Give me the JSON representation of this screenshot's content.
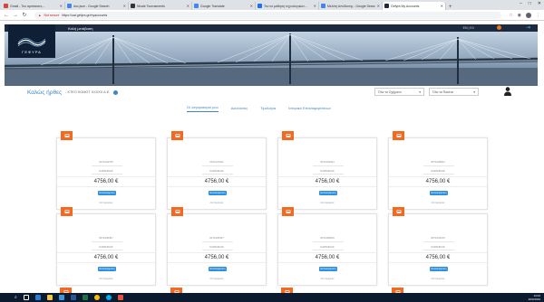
{
  "browser": {
    "tabs": [
      {
        "title": "Gmail - Του αγαπαοτες...",
        "color": "#d44638",
        "active": false
      },
      {
        "title": "doc.json - Google Search",
        "color": "#4285f4",
        "active": false
      },
      {
        "title": "Nivale Tournaments",
        "color": "#333333",
        "active": false
      },
      {
        "title": "Google Translate",
        "color": "#4285f4",
        "active": false
      },
      {
        "title": "Τον σε μάθηση τεχνολογικών...",
        "color": "#1a73e8",
        "active": false
      },
      {
        "title": "Μελέτη Απόδοσης - Google Search",
        "color": "#4285f4",
        "active": false
      },
      {
        "title": "Gefyra My Accounts",
        "color": "#1c2a3f",
        "active": true
      }
    ],
    "new_tab": "+",
    "window_controls": [
      "–",
      "□",
      "✕"
    ],
    "not_secure": "Not secure",
    "url": "https://uat.gefyra.gr/myaccounts"
  },
  "header": {
    "brand": "ΓΕΦΥΡΑ",
    "tagline": "Καλή μετάβαση",
    "lang": "EN | ΕΛ"
  },
  "user": {
    "welcome": "Καλώς ήρθες",
    "company": "- ΚΤΕΟ ΚΟΜΟΤ ΧΧΧΧΧ Α.Ε.",
    "filter1": "Όλα τα Οχήματα",
    "filter2": "Όλα τα Πακέτα",
    "caret": "▾"
  },
  "tabs": [
    {
      "label": "Οι λογαριασμοί μου",
      "active": true
    },
    {
      "label": "Διελεύσεις",
      "active": false
    },
    {
      "label": "Τιμολόγια",
      "active": false
    },
    {
      "label": "Ιστορικό Επαναφορτίσεων",
      "active": false
    }
  ],
  "cards": [
    {
      "line1": "0071234475",
      "line2": "ΚΑΡΑΝΙΚΑΣ",
      "amount": "4756,00 €",
      "button": "Επαναφόρτιση",
      "foot": "Λεπτομέρειες"
    },
    {
      "line1": "0071237011",
      "line2": "ΚΑΡΑΝΙΚΑΣ",
      "amount": "4756,00 €",
      "button": "Επαναφόρτιση",
      "foot": "Λεπτομέρειες"
    },
    {
      "line1": "0071234261",
      "line2": "ΚΑΡΑΝΙΚΑΣ",
      "amount": "4756,00 €",
      "button": "Επαναφόρτιση",
      "foot": "Λεπτομέρειες"
    },
    {
      "line1": "0071235601",
      "line2": "ΚΑΡΑΝΙΚΑΣ",
      "amount": "4756,00 €",
      "button": "Επαναφόρτιση",
      "foot": "Λεπτομέρειες"
    },
    {
      "line1": "0071236307",
      "line2": "ΚΑΡΑΝΙΚΑΣ",
      "amount": "4756,00 €",
      "button": "Επαναφόρτιση",
      "foot": "Λεπτομέρειες"
    },
    {
      "line1": "0071235437",
      "line2": "ΚΑΡΑΝΙΚΑΣ",
      "amount": "4756,00 €",
      "button": "Επαναφόρτιση",
      "foot": "Λεπτομέρειες"
    },
    {
      "line1": "0071236810",
      "line2": "ΚΑΡΑΝΙΚΑΣ",
      "amount": "4756,00 €",
      "button": "Επαναφόρτιση",
      "foot": "Λεπτομέρειες"
    },
    {
      "line1": "0071231070",
      "line2": "ΚΑΡΑΝΙΚΑΣ",
      "amount": "4756,00 €",
      "button": "Επαναφόρτιση",
      "foot": "Λεπτομέρειες"
    }
  ],
  "taskbar": {
    "time": "13:02",
    "date": "26/3/2019"
  },
  "colors": {
    "accent": "#3b86c6",
    "tag": "#f26a22",
    "button": "#2d8fdf",
    "header_dark": "#1c2a3f"
  }
}
